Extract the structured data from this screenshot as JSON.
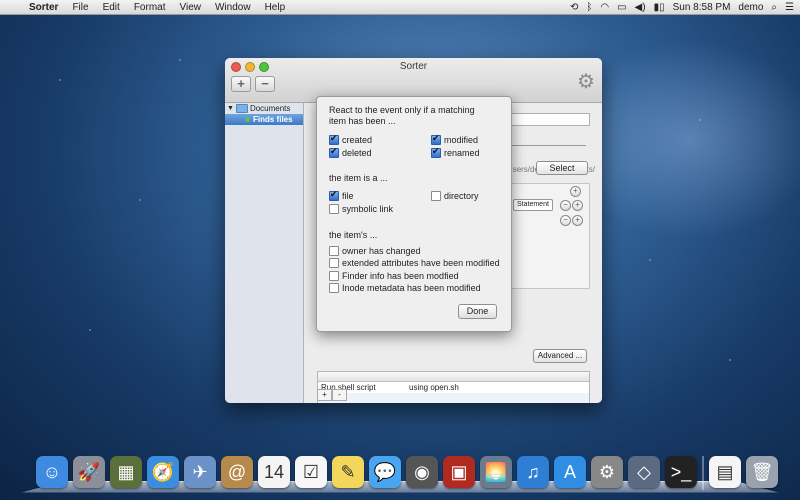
{
  "menubar": {
    "apple": "",
    "app_name": "Sorter",
    "items": [
      "File",
      "Edit",
      "Format",
      "View",
      "Window",
      "Help"
    ],
    "clock": "Sun 8:58 PM",
    "user": "demo"
  },
  "window": {
    "title": "Sorter",
    "toolbar": {
      "add": "+",
      "remove": "−"
    }
  },
  "sidebar": {
    "items": [
      {
        "label": "Documents",
        "selected": false
      },
      {
        "label": "Finds files",
        "selected": true
      }
    ]
  },
  "main": {
    "path_text": "file:///localhost/Users/demo/Documents/",
    "select_button": "Select",
    "statement_label": "Statement",
    "advanced_button": "Advanced ...",
    "actions": [
      {
        "action": "Run shell script",
        "target": "using open.sh"
      }
    ],
    "add": "+",
    "remove": "-"
  },
  "popover": {
    "intro_line1": "React to the event only if a matching",
    "intro_line2": "item has been ...",
    "events": [
      {
        "label": "created",
        "checked": true
      },
      {
        "label": "modified",
        "checked": true
      },
      {
        "label": "deleted",
        "checked": true
      },
      {
        "label": "renamed",
        "checked": true
      }
    ],
    "item_heading": "the item is a ...",
    "item_types": [
      {
        "label": "file",
        "checked": true
      },
      {
        "label": "directory",
        "checked": false
      },
      {
        "label": "symbolic link",
        "checked": false
      }
    ],
    "item_s_heading": "the item's ...",
    "changes": [
      {
        "label": "owner has changed",
        "checked": false
      },
      {
        "label": "extended attributes have been modified",
        "checked": false
      },
      {
        "label": "Finder info has been modfied",
        "checked": false
      },
      {
        "label": "Inode metadata has been modified",
        "checked": false
      }
    ],
    "done_button": "Done"
  },
  "dock": {
    "apps": [
      {
        "name": "finder",
        "color": "#3d8ae0",
        "glyph": "☺"
      },
      {
        "name": "launchpad",
        "color": "#8a8f99",
        "glyph": "🚀"
      },
      {
        "name": "mission-control",
        "color": "#5a6f3a",
        "glyph": "▦"
      },
      {
        "name": "safari",
        "color": "#3b8de0",
        "glyph": "🧭"
      },
      {
        "name": "mail",
        "color": "#6a92c9",
        "glyph": "✈"
      },
      {
        "name": "contacts",
        "color": "#b58a4a",
        "glyph": "@"
      },
      {
        "name": "calendar",
        "color": "#f4f4f4",
        "glyph": "14"
      },
      {
        "name": "reminders",
        "color": "#f7f7f7",
        "glyph": "☑"
      },
      {
        "name": "notes",
        "color": "#f2d75a",
        "glyph": "✎"
      },
      {
        "name": "messages",
        "color": "#4aa5f0",
        "glyph": "💬"
      },
      {
        "name": "facetime",
        "color": "#555",
        "glyph": "◉"
      },
      {
        "name": "photo-booth",
        "color": "#b02a20",
        "glyph": "▣"
      },
      {
        "name": "iphoto",
        "color": "#6b7a8c",
        "glyph": "🌅"
      },
      {
        "name": "itunes",
        "color": "#2e7fd3",
        "glyph": "♫"
      },
      {
        "name": "app-store",
        "color": "#2f8de4",
        "glyph": "A"
      },
      {
        "name": "system-preferences",
        "color": "#888",
        "glyph": "⚙"
      },
      {
        "name": "sorter",
        "color": "#5a6a80",
        "glyph": "◇"
      },
      {
        "name": "terminal",
        "color": "#222",
        "glyph": ">_"
      },
      {
        "name": "document",
        "color": "#f5f5f5",
        "glyph": "▤"
      },
      {
        "name": "trash",
        "color": "#9aa3ad",
        "glyph": "🗑"
      }
    ]
  }
}
